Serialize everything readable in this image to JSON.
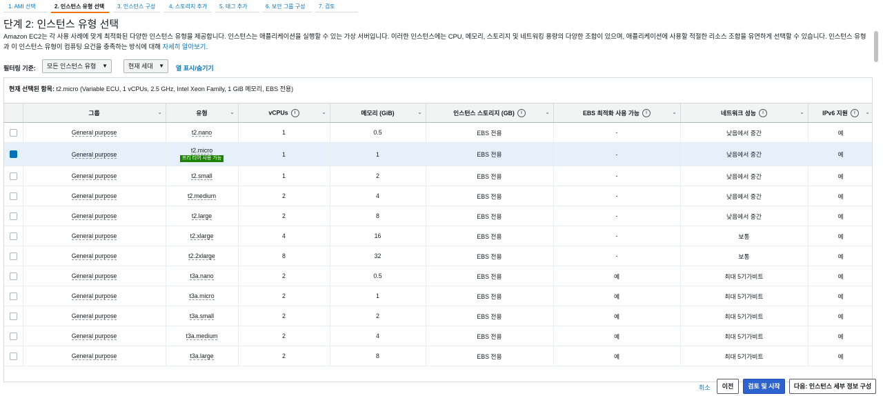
{
  "wizard": {
    "steps": [
      "1. AMI 선택",
      "2. 인스턴스 유형 선택",
      "3. 인스턴스 구성",
      "4. 스토리지 추가",
      "5. 태그 추가",
      "6. 보안 그룹 구성",
      "7. 검토"
    ],
    "active_index": 1
  },
  "page": {
    "title": "단계 2: 인스턴스 유형 선택",
    "description": "Amazon EC2는 각 사용 사례에 맞게 최적화된 다양한 인스턴스 유형을 제공합니다. 인스턴스는 애플리케이션을 실행할 수 있는 가상 서버입니다. 이러한 인스턴스에는 CPU, 메모리, 스토리지 및 네트워킹 용량의 다양한 조합이 있으며, 애플리케이션에 사용할 적절한 리소스 조합을 유연하게 선택할 수 있습니다. 인스턴스 유형과 이 인스턴스 유형이 컴퓨팅 요건을 충족하는 방식에 대해",
    "learn_more": "자세히 알아보기",
    "period": "."
  },
  "filter": {
    "label": "필터링 기준:",
    "type_select": "모든 인스턴스 유형",
    "generation_select": "현재 세대",
    "toggle_columns": "열 표시/숨기기"
  },
  "current_selection": {
    "label": "현재 선택된 항목:",
    "value": "t2.micro (Variable ECU, 1 vCPUs, 2.5 GHz, Intel Xeon Family, 1 GiB 메모리, EBS 전용)"
  },
  "table": {
    "headers": [
      "그룹",
      "유형",
      "vCPUs",
      "메모리 (GiB)",
      "인스턴스 스토리지 (GB)",
      "EBS 최적화 사용 가능",
      "네트워크 성능",
      "IPv6 지원"
    ],
    "free_tier_badge": "프리 티어 사용 가능",
    "rows": [
      {
        "group": "General purpose",
        "type": "t2.nano",
        "vcpus": "1",
        "memory": "0.5",
        "storage": "EBS 전용",
        "ebs": "-",
        "network": "낮음에서 중간",
        "ipv6": "예",
        "selected": false
      },
      {
        "group": "General purpose",
        "type": "t2.micro",
        "vcpus": "1",
        "memory": "1",
        "storage": "EBS 전용",
        "ebs": "-",
        "network": "낮음에서 중간",
        "ipv6": "예",
        "selected": true
      },
      {
        "group": "General purpose",
        "type": "t2.small",
        "vcpus": "1",
        "memory": "2",
        "storage": "EBS 전용",
        "ebs": "-",
        "network": "낮음에서 중간",
        "ipv6": "예",
        "selected": false
      },
      {
        "group": "General purpose",
        "type": "t2.medium",
        "vcpus": "2",
        "memory": "4",
        "storage": "EBS 전용",
        "ebs": "-",
        "network": "낮음에서 중간",
        "ipv6": "예",
        "selected": false
      },
      {
        "group": "General purpose",
        "type": "t2.large",
        "vcpus": "2",
        "memory": "8",
        "storage": "EBS 전용",
        "ebs": "-",
        "network": "낮음에서 중간",
        "ipv6": "예",
        "selected": false
      },
      {
        "group": "General purpose",
        "type": "t2.xlarge",
        "vcpus": "4",
        "memory": "16",
        "storage": "EBS 전용",
        "ebs": "-",
        "network": "보통",
        "ipv6": "예",
        "selected": false
      },
      {
        "group": "General purpose",
        "type": "t2.2xlarge",
        "vcpus": "8",
        "memory": "32",
        "storage": "EBS 전용",
        "ebs": "-",
        "network": "보통",
        "ipv6": "예",
        "selected": false
      },
      {
        "group": "General purpose",
        "type": "t3a.nano",
        "vcpus": "2",
        "memory": "0.5",
        "storage": "EBS 전용",
        "ebs": "예",
        "network": "최대 5기가비트",
        "ipv6": "예",
        "selected": false
      },
      {
        "group": "General purpose",
        "type": "t3a.micro",
        "vcpus": "2",
        "memory": "1",
        "storage": "EBS 전용",
        "ebs": "예",
        "network": "최대 5기가비트",
        "ipv6": "예",
        "selected": false
      },
      {
        "group": "General purpose",
        "type": "t3a.small",
        "vcpus": "2",
        "memory": "2",
        "storage": "EBS 전용",
        "ebs": "예",
        "network": "최대 5기가비트",
        "ipv6": "예",
        "selected": false
      },
      {
        "group": "General purpose",
        "type": "t3a.medium",
        "vcpus": "2",
        "memory": "4",
        "storage": "EBS 전용",
        "ebs": "예",
        "network": "최대 5기가비트",
        "ipv6": "예",
        "selected": false
      },
      {
        "group": "General purpose",
        "type": "t3a.large",
        "vcpus": "2",
        "memory": "8",
        "storage": "EBS 전용",
        "ebs": "예",
        "network": "최대 5기가비트",
        "ipv6": "예",
        "selected": false
      }
    ]
  },
  "footer": {
    "cancel": "취소",
    "previous": "이전",
    "review_launch": "검토 및 시작",
    "next": "다음: 인스턴스 세부 정보 구성"
  }
}
